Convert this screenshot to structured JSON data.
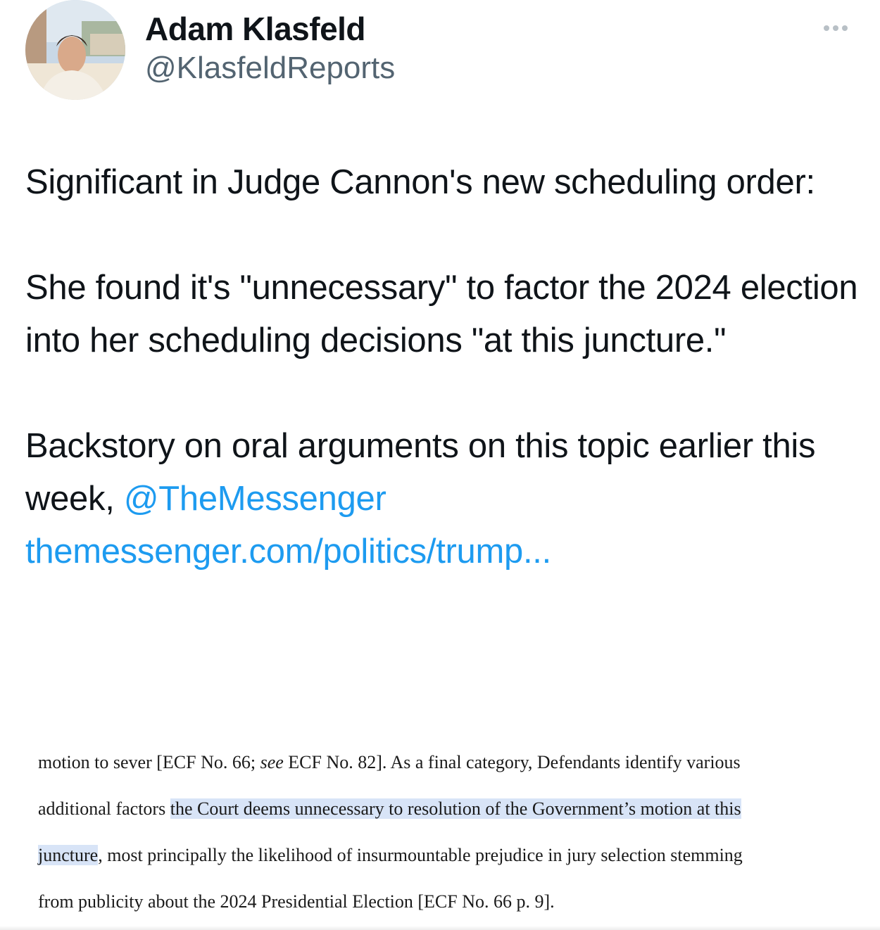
{
  "author": {
    "name": "Adam Klasfeld",
    "handle": "@KlasfeldReports",
    "avatar_icon": "profile-photo"
  },
  "more_icon": "more-options-icon",
  "tweet": {
    "p1": "Significant in Judge Cannon's new scheduling order:",
    "p2": "She found it's \"unnecessary\" to factor the 2024 election into her scheduling decisions \"at this juncture.\"",
    "p3_text": "Backstory on oral arguments on this topic earlier this week, ",
    "mention": "@TheMessenger",
    "url": "themessenger.com/politics/trump..."
  },
  "document": {
    "line1": "motion to sever [ECF No. 66; ",
    "line1_italic": "see",
    "line1_rest": " ECF No. 82].  As a final category, Defendants identify various",
    "line2_pre": "additional factors ",
    "line2_hl": "the Court deems unnecessary to resolution of the Government’s motion at this",
    "line3_hl": "juncture",
    "line3_post": ", most principally the likelihood of insurmountable prejudice in jury selection stemming",
    "line4": "from publicity about the 2024 Presidential Election [ECF No. 66 p. 9]."
  },
  "colors": {
    "link": "#1d9bf0",
    "highlight": "#d8e4f7",
    "handle": "#536471"
  }
}
